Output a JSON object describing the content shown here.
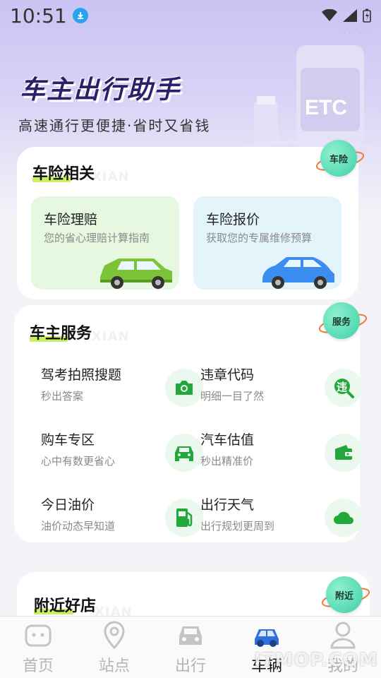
{
  "status_bar": {
    "time": "10:51"
  },
  "hero": {
    "title": "车主出行助手",
    "subtitle": "高速通行更便捷·省时又省钱",
    "etc_sign": "ETC"
  },
  "insurance": {
    "title": "车险相关",
    "badge": "车险",
    "tiles": [
      {
        "title": "车险理赔",
        "subtitle": "您的省心理赔计算指南",
        "bg": "#e6f8df"
      },
      {
        "title": "车险报价",
        "subtitle": "获取您的专属维修预算",
        "bg": "#e3f5fb"
      }
    ]
  },
  "services": {
    "title": "车主服务",
    "badge": "服务",
    "items": [
      {
        "title": "驾考拍照搜题",
        "subtitle": "秒出答案",
        "icon": "camera-icon"
      },
      {
        "title": "违章代码",
        "subtitle": "明细一目了然",
        "icon": "violation-search-icon",
        "icon_text": "违"
      },
      {
        "title": "购车专区",
        "subtitle": "心中有数更省心",
        "icon": "car-icon"
      },
      {
        "title": "汽车估值",
        "subtitle": "秒出精准价",
        "icon": "wallet-icon"
      },
      {
        "title": "今日油价",
        "subtitle": "油价动态早知道",
        "icon": "fuel-pump-icon"
      },
      {
        "title": "出行天气",
        "subtitle": "出行规划更周到",
        "icon": "cloud-icon"
      }
    ]
  },
  "nearby": {
    "title": "附近好店",
    "badge": "附近"
  },
  "tabbar": {
    "tabs": [
      {
        "label": "首页",
        "icon": "home-icon",
        "active": false
      },
      {
        "label": "站点",
        "icon": "location-pin-icon",
        "active": false
      },
      {
        "label": "出行",
        "icon": "car-front-icon",
        "active": false
      },
      {
        "label": "车辆",
        "icon": "car-blue-icon",
        "active": true
      },
      {
        "label": "我的",
        "icon": "user-icon",
        "active": false
      }
    ]
  },
  "watermark": "ITMOP.COM",
  "colors": {
    "accent_green": "#22a83a",
    "underline": "#c9f062",
    "badge": "#3fd0a8",
    "active_tab": "#2f6fe0"
  }
}
